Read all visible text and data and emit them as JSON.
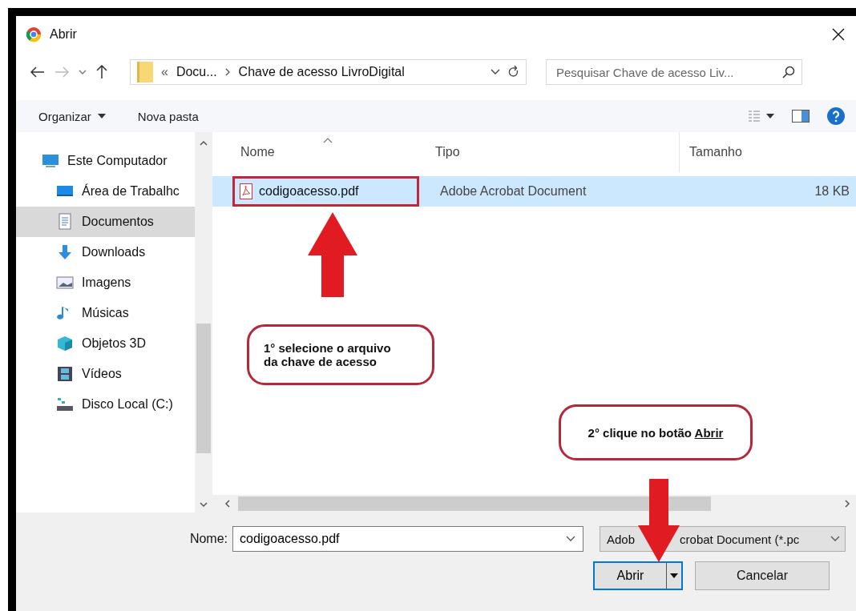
{
  "window": {
    "title": "Abrir"
  },
  "address": {
    "overflow": "«",
    "crumbs": [
      "Docu...",
      "Chave de acesso LivroDigital"
    ]
  },
  "search": {
    "placeholder": "Pesquisar Chave de acesso Liv..."
  },
  "toolbar": {
    "organize": "Organizar",
    "new_folder": "Nova pasta"
  },
  "nav": {
    "items": [
      {
        "label": "Este Computador",
        "selected": false,
        "children": [
          {
            "label": "Área de Trabalhc",
            "selected": false
          },
          {
            "label": "Documentos",
            "selected": true
          },
          {
            "label": "Downloads",
            "selected": false
          },
          {
            "label": "Imagens",
            "selected": false
          },
          {
            "label": "Músicas",
            "selected": false
          },
          {
            "label": "Objetos 3D",
            "selected": false
          },
          {
            "label": "Vídeos",
            "selected": false
          },
          {
            "label": "Disco Local (C:)",
            "selected": false
          }
        ]
      }
    ]
  },
  "table": {
    "columns": [
      "Nome",
      "Tipo",
      "Tamanho"
    ],
    "rows": [
      {
        "name": "codigoacesso.pdf",
        "type": "Adobe Acrobat Document",
        "size": "18 KB",
        "selected": true
      }
    ]
  },
  "footer": {
    "name_label": "Nome:",
    "name_value": "codigoacesso.pdf",
    "file_type": [
      "Adob",
      "crobat Document (*.pc"
    ],
    "open": "Abrir",
    "cancel": "Cancelar"
  },
  "annotations": [
    {
      "text": "1° selecione o arquivo da chave de acesso"
    },
    {
      "text": "2° clique no botão ",
      "underlined": "Abrir"
    }
  ]
}
